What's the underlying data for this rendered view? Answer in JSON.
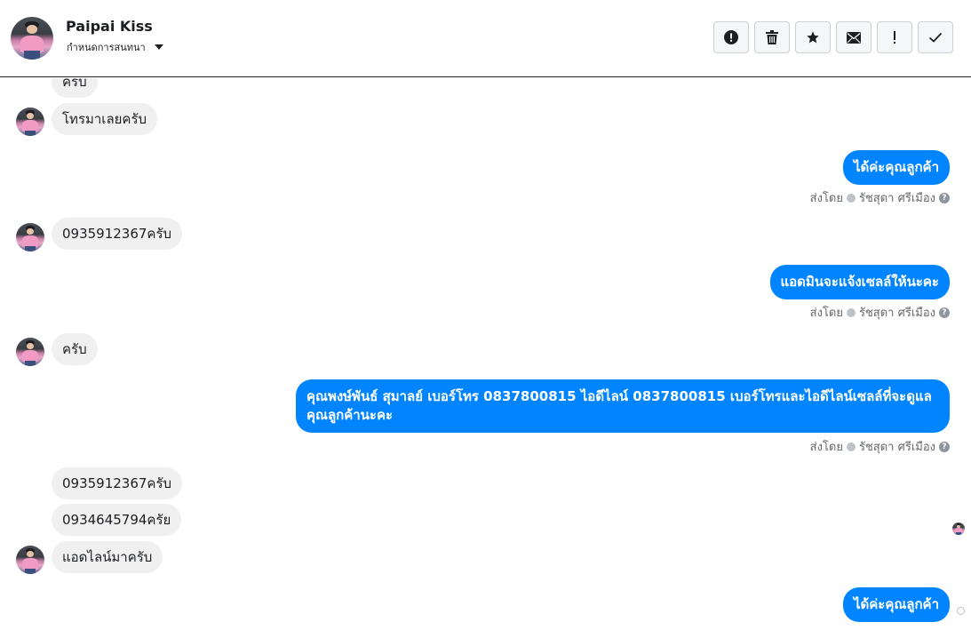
{
  "header": {
    "name": "Paipai Kiss",
    "assign_label": "กำหนดการสนทนา",
    "actions": [
      "mark-spam",
      "delete",
      "star",
      "mark-unread",
      "important",
      "done"
    ]
  },
  "messages": {
    "m0": "ครับ",
    "m1": "โทรมาเลยครับ",
    "m2": "ได้ค่ะคุณลูกค้า",
    "m3": "0935912367ครับ",
    "m4": "แอดมินจะแจ้งเซลล์ให้นะคะ",
    "m5": "ครับ",
    "m6": "คุณพงษ์พันธ์ สุมาลย์      เบอร์โทร 0837800815  ไอดีไลน์ 0837800815   เบอร์โทรและไอดีไลน์เซลล์ที่จะดูแลคุณลูกค้านะคะ",
    "m7": "0935912367ครับ",
    "m8": "0934645794ครัย",
    "m9": "แอดไลน์มาครับ",
    "m10": "ได้ค่ะคุณลูกค้า"
  },
  "sent_by": {
    "prefix": "ส่งโดย",
    "agent": "รัชสุดา ศรีเมือง",
    "help": "?"
  },
  "colors": {
    "outgoing": "#0084ff",
    "incoming": "#f0f0f0"
  }
}
